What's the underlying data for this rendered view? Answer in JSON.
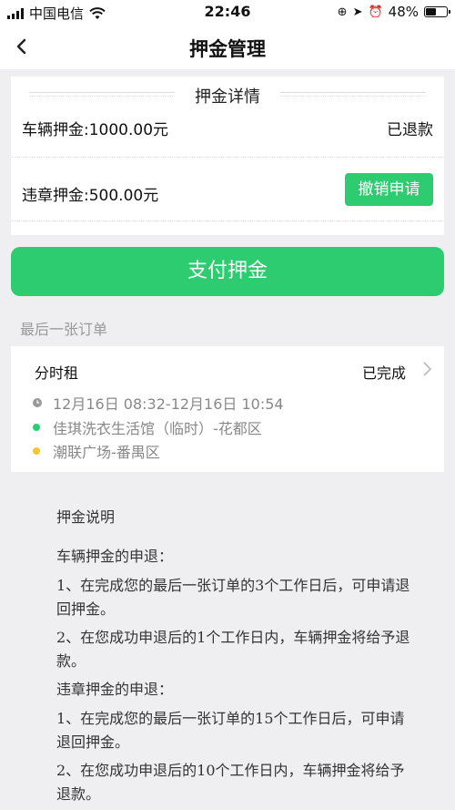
{
  "status_bar": {
    "carrier": "中国电信",
    "time": "22:46",
    "battery": "48%",
    "battery_level": 0.48
  },
  "nav": {
    "title": "押金管理"
  },
  "deposit": {
    "heading": "押金详情",
    "vehicle_deposit": "车辆押金:1000.00元",
    "vehicle_status": "已退款",
    "violation_deposit": "违章押金:500.00元",
    "cancel_label": "撤销申请"
  },
  "pay_button": "支付押金",
  "last_order": {
    "title": "最后一张订单",
    "type": "分时租",
    "status": "已完成",
    "time": "12月16日 08:32-12月16日 10:54",
    "start": "佳琪洗衣生活馆（临时）-花都区",
    "end": "潮联广场-番禺区"
  },
  "explanation": {
    "title": "押金说明",
    "vehicle_title": "车辆押金的申退：",
    "vehicle_1": "1、在完成您的最后一张订单的3个工作日后，可申请退回押金。",
    "vehicle_2": "2、在您成功申退后的1个工作日内，车辆押金将给予退款。",
    "violation_title": "违章押金的申退：",
    "violation_1": "1、在完成您的最后一张订单的15个工作日后，可申请退回押金。",
    "violation_2": "2、在您成功申退后的10个工作日内，车辆押金将给予退款。"
  },
  "colors": {
    "accent": "#2ecc71",
    "dot_start": "#2ecc71",
    "dot_end": "#f7c531"
  }
}
